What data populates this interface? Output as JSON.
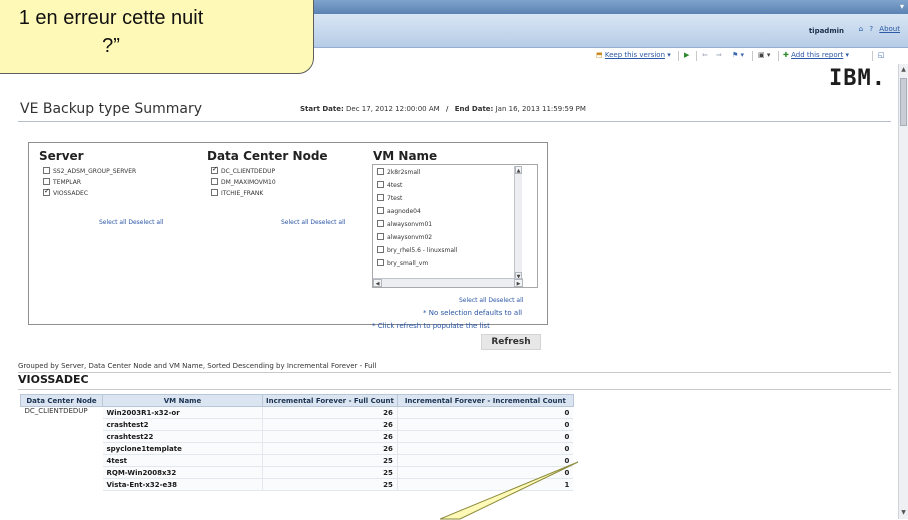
{
  "topbar": {
    "dropdown_icon": "chevron-down-icon"
  },
  "userbar": {
    "user": "tipadmin",
    "about": "About"
  },
  "toolbar": {
    "keep_version": "Keep this version",
    "add_report": "Add this report",
    "icons": [
      "keep-version-icon",
      "run-icon",
      "back-icon",
      "forward-icon",
      "drill-icon",
      "output-icon",
      "add-report-icon"
    ]
  },
  "brand": {
    "logo": "IBM."
  },
  "report": {
    "title": "VE Backup type Summary",
    "start_label": "Start Date:",
    "start_value": "Dec 17, 2012 12:00:00 AM",
    "separator": "/",
    "end_label": "End Date:",
    "end_value": "Jan 16, 2013 11:59:59 PM"
  },
  "filters": {
    "server": {
      "heading": "Server",
      "items": [
        {
          "label": "SS2_ADSM_GROUP_SERVER",
          "checked": false
        },
        {
          "label": "TEMPLAR",
          "checked": false
        },
        {
          "label": "VIOSSADEC",
          "checked": true
        }
      ],
      "select_all": "Select all",
      "deselect_all": "Deselect all"
    },
    "dcnode": {
      "heading": "Data Center Node",
      "items": [
        {
          "label": "DC_CLIENTDEDUP",
          "checked": true
        },
        {
          "label": "DM_MAXIMOVM10",
          "checked": false
        },
        {
          "label": "ITCHIE_FRANK",
          "checked": false
        }
      ],
      "select_all": "Select all",
      "deselect_all": "Deselect all"
    },
    "vm": {
      "heading": "VM Name",
      "items": [
        {
          "label": "2k8r2small",
          "checked": false
        },
        {
          "label": "4test",
          "checked": false
        },
        {
          "label": "7test",
          "checked": false
        },
        {
          "label": "aagnode04",
          "checked": false
        },
        {
          "label": "alwaysonvm01",
          "checked": false
        },
        {
          "label": "alwaysonvm02",
          "checked": false
        },
        {
          "label": "bry_rhel5.6 - linuxsmall",
          "checked": false
        },
        {
          "label": "bry_small_vm",
          "checked": false
        }
      ],
      "select_all": "Select all",
      "deselect_all": "Deselect all"
    },
    "note_default": "* No selection defaults to all",
    "note_refresh": "* Click refresh to populate the list",
    "refresh_button": "Refresh"
  },
  "grouping_text": "Grouped by Server, Data Center Node and VM Name, Sorted Descending by Incremental Forever - Full",
  "section_title": "VIOSSADEC",
  "table": {
    "headers": [
      "Data Center Node",
      "VM Name",
      "Incremental Forever - Full Count",
      "Incremental Forever - Incremental Count"
    ],
    "node": "DC_CLIENTDEDUP",
    "rows": [
      [
        "Win2003R1-x32-or",
        "26",
        "0"
      ],
      [
        "crashtest2",
        "26",
        "0"
      ],
      [
        "crashtest22",
        "26",
        "0"
      ],
      [
        "spyclone1template",
        "26",
        "0"
      ],
      [
        "4test",
        "25",
        "0"
      ],
      [
        "RQM-Win2008x32",
        "25",
        "0"
      ],
      [
        "Vista-Ent-x32-e38",
        "25",
        "1"
      ]
    ]
  },
  "callout": {
    "line1": "1 en erreur cette nuit",
    "line2": "?”"
  }
}
